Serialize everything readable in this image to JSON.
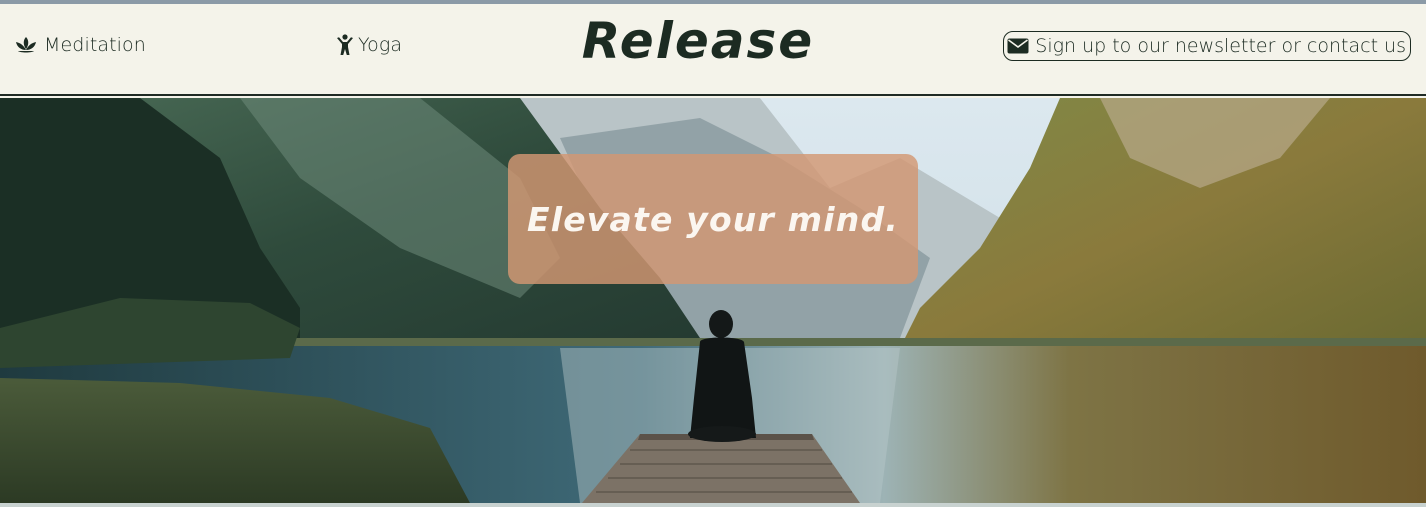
{
  "header": {
    "nav": [
      {
        "label": "Meditation",
        "icon": "lotus-icon"
      },
      {
        "label": "Yoga",
        "icon": "yoga-person-icon"
      }
    ],
    "brand": "Release",
    "newsletter": {
      "label": "Sign up to our newsletter or contact us",
      "icon": "envelope-icon"
    }
  },
  "hero": {
    "tagline": "Elevate your mind.",
    "image": "person-meditating-on-pier-by-mountain-lake"
  },
  "colors": {
    "header_bg": "#f4f3ea",
    "text": "#1c2b22",
    "tagline_box": "#d39773",
    "tagline_text": "#fbf6f0"
  }
}
